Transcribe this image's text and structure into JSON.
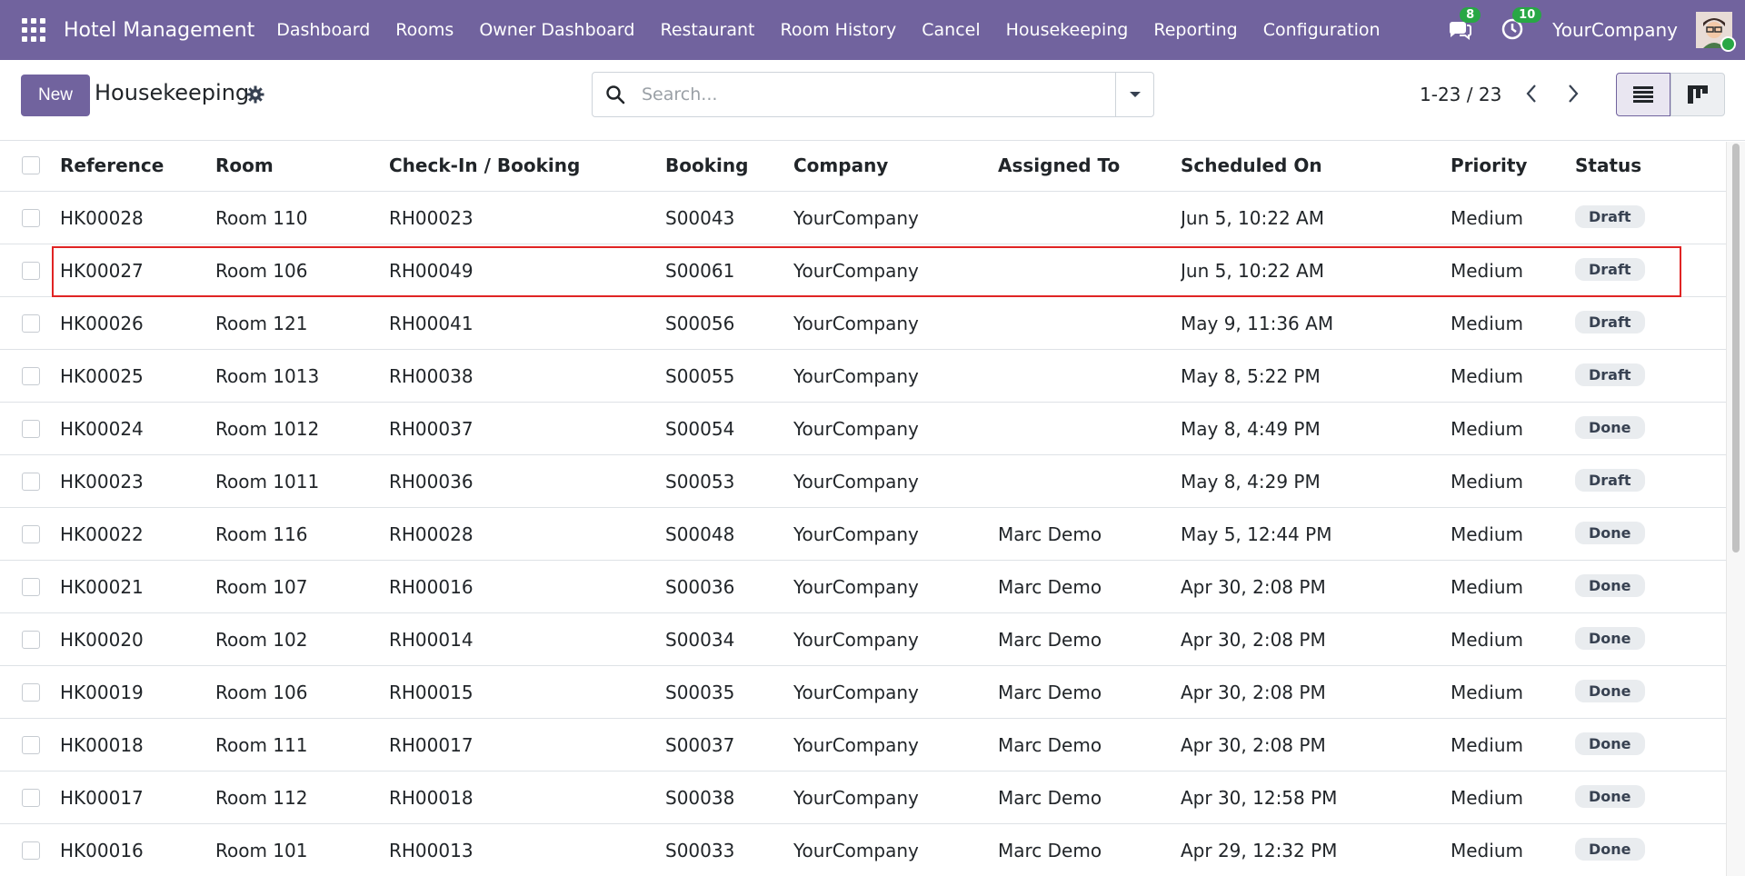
{
  "navbar": {
    "brand": "Hotel Management",
    "menu": [
      "Dashboard",
      "Rooms",
      "Owner Dashboard",
      "Restaurant",
      "Room History",
      "Cancel",
      "Housekeeping",
      "Reporting",
      "Configuration"
    ],
    "messages_count": "8",
    "activities_count": "10",
    "company": "YourCompany"
  },
  "control": {
    "new_label": "New",
    "title": "Housekeeping",
    "search_placeholder": "Search...",
    "pager": "1-23 / 23"
  },
  "table": {
    "headers": [
      "Reference",
      "Room",
      "Check-In / Booking",
      "Booking",
      "Company",
      "Assigned To",
      "Scheduled On",
      "Priority",
      "Status"
    ],
    "rows": [
      [
        "HK00028",
        "Room 110",
        "RH00023",
        "S00043",
        "YourCompany",
        "",
        "Jun 5, 10:22 AM",
        "Medium",
        "Draft"
      ],
      [
        "HK00027",
        "Room 106",
        "RH00049",
        "S00061",
        "YourCompany",
        "",
        "Jun 5, 10:22 AM",
        "Medium",
        "Draft"
      ],
      [
        "HK00026",
        "Room 121",
        "RH00041",
        "S00056",
        "YourCompany",
        "",
        "May 9, 11:36 AM",
        "Medium",
        "Draft"
      ],
      [
        "HK00025",
        "Room 1013",
        "RH00038",
        "S00055",
        "YourCompany",
        "",
        "May 8, 5:22 PM",
        "Medium",
        "Draft"
      ],
      [
        "HK00024",
        "Room 1012",
        "RH00037",
        "S00054",
        "YourCompany",
        "",
        "May 8, 4:49 PM",
        "Medium",
        "Done"
      ],
      [
        "HK00023",
        "Room 1011",
        "RH00036",
        "S00053",
        "YourCompany",
        "",
        "May 8, 4:29 PM",
        "Medium",
        "Draft"
      ],
      [
        "HK00022",
        "Room 116",
        "RH00028",
        "S00048",
        "YourCompany",
        "Marc Demo",
        "May 5, 12:44 PM",
        "Medium",
        "Done"
      ],
      [
        "HK00021",
        "Room 107",
        "RH00016",
        "S00036",
        "YourCompany",
        "Marc Demo",
        "Apr 30, 2:08 PM",
        "Medium",
        "Done"
      ],
      [
        "HK00020",
        "Room 102",
        "RH00014",
        "S00034",
        "YourCompany",
        "Marc Demo",
        "Apr 30, 2:08 PM",
        "Medium",
        "Done"
      ],
      [
        "HK00019",
        "Room 106",
        "RH00015",
        "S00035",
        "YourCompany",
        "Marc Demo",
        "Apr 30, 2:08 PM",
        "Medium",
        "Done"
      ],
      [
        "HK00018",
        "Room 111",
        "RH00017",
        "S00037",
        "YourCompany",
        "Marc Demo",
        "Apr 30, 2:08 PM",
        "Medium",
        "Done"
      ],
      [
        "HK00017",
        "Room 112",
        "RH00018",
        "S00038",
        "YourCompany",
        "Marc Demo",
        "Apr 30, 12:58 PM",
        "Medium",
        "Done"
      ],
      [
        "HK00016",
        "Room 101",
        "RH00013",
        "S00033",
        "YourCompany",
        "Marc Demo",
        "Apr 29, 12:32 PM",
        "Medium",
        "Done"
      ]
    ]
  },
  "colors": {
    "navbar": "#71639e",
    "badge_green": "#28a745",
    "highlight": "#e02424"
  }
}
